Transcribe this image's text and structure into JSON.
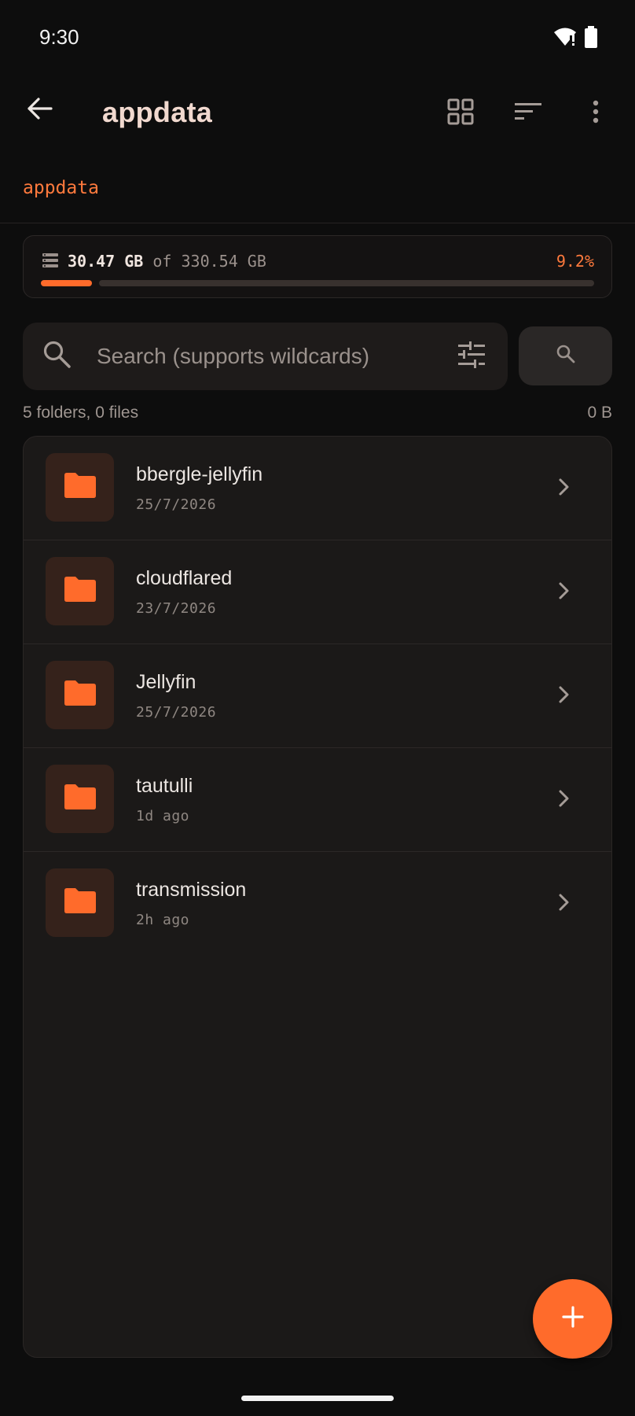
{
  "status_bar": {
    "time": "9:30"
  },
  "app_bar": {
    "title": "appdata"
  },
  "breadcrumb": {
    "path": "appdata"
  },
  "storage": {
    "used": "30.47 GB",
    "of_label": "of",
    "total": "330.54 GB",
    "percent_label": "9.2%",
    "fraction": 0.092
  },
  "search": {
    "placeholder": "Search (supports wildcards)",
    "value": ""
  },
  "summary": {
    "counts": "5 folders, 0 files",
    "size": "0 B"
  },
  "items": [
    {
      "name": "bbergle-jellyfin",
      "date": "25/7/2026",
      "icon": "folder-icon"
    },
    {
      "name": "cloudflared",
      "date": "23/7/2026",
      "icon": "folder-icon"
    },
    {
      "name": "Jellyfin",
      "date": "25/7/2026",
      "icon": "folder-icon"
    },
    {
      "name": "tautulli",
      "date": "1d ago",
      "icon": "folder-icon"
    },
    {
      "name": "transmission",
      "date": "2h ago",
      "icon": "folder-icon"
    }
  ],
  "colors": {
    "accent": "#ff6b2b",
    "background": "#0d0d0d",
    "surface": "#1b1918",
    "folder_tile": "#35221b"
  }
}
